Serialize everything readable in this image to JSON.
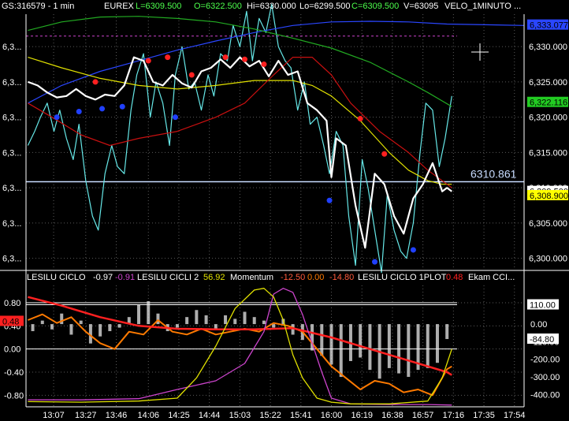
{
  "header": {
    "symbol": "GS:316579 - 1 min",
    "exchange": "EUREX",
    "last": "L=6309.500",
    "open": "O=6322.500",
    "high": "Hi=6330.000",
    "low": "Lo=6299.500",
    "close": "C=6309.500",
    "volume": "V=63095",
    "indicator": "VELO_1MINUTO",
    "dots": "..."
  },
  "indicator_header": {
    "ind1_name": "LESILU CICLO",
    "ind1_v1": "-0.97",
    "ind1_v2": "-0.91",
    "ind2_name": "LESILU CICLI 2",
    "ind2_v1": "56.92",
    "ind3_name": "Momentum",
    "ind3_v1": "-12.50",
    "ind3_v2": "0.00",
    "ind3_v3": "-14.80",
    "ind4_name": "LESILU CICLO 1PLOT",
    "ind4_v1": "0.48",
    "ind5_name": "Ekam CCI..."
  },
  "colors": {
    "background": "#000000",
    "grid": "#5a5a5a",
    "price": "#ffffff",
    "fast": "#66e8e8",
    "blue_ma": "#2a46ff",
    "green_ma": "#22aa22",
    "yellow_ma": "#e0e000",
    "red_ma": "#c81010",
    "hline": "#c8dcff",
    "magenta": "#cc44cc",
    "orange": "#ff7a00",
    "red_dot": "#ff2020",
    "blue_dot": "#2040ff"
  },
  "chart_data": [
    {
      "type": "line",
      "title": "",
      "x_ticks": [
        "13:07",
        "13:27",
        "13:46",
        "14:06",
        "14:25",
        "14:44",
        "15:03",
        "15:22",
        "15:41",
        "16:00",
        "16:19",
        "16:38",
        "16:57",
        "17:16",
        "17:35",
        "17:54"
      ],
      "y_ticks": [
        6300,
        6305,
        6310,
        6315,
        6320,
        6325,
        6330
      ],
      "y_tick_labels": [
        "6,300.000",
        "6,305.000",
        "6,310.000",
        "6,315.000",
        "6,320.000",
        "6,325.000",
        "6,330.000"
      ],
      "left_labels": [
        "6,3...",
        "6,3...",
        "6,3...",
        "6,3...",
        "6,3...",
        "6,3...",
        "6,3..."
      ],
      "ylim": [
        6298.4,
        6334.6
      ],
      "xlim": [
        12.83,
        18.0
      ],
      "horizontal_line": 6310.861,
      "horizontal_line_label": "6310.861",
      "badges": [
        {
          "text": "6,333.077",
          "value": 6333.077,
          "bg": "#2a46ff",
          "fg": "#000000"
        },
        {
          "text": "6,322.116",
          "value": 6322.116,
          "bg": "#22cc22",
          "fg": "#000000"
        },
        {
          "text": "6,309.500",
          "value": 6309.5,
          "bg": "#ffffff",
          "fg": "#000000"
        },
        {
          "text": "6,308.900",
          "value": 6308.9,
          "bg": "#ffff00",
          "fg": "#000000"
        }
      ],
      "series": [
        {
          "role": "price",
          "color": "#ffffff",
          "x": [
            12.85,
            12.95,
            13.05,
            13.15,
            13.25,
            13.35,
            13.45,
            13.55,
            13.65,
            13.75,
            13.85,
            13.95,
            14.05,
            14.15,
            14.25,
            14.35,
            14.45,
            14.55,
            14.65,
            14.75,
            14.85,
            14.95,
            15.05,
            15.15,
            15.25,
            15.35,
            15.45,
            15.55,
            15.65,
            15.75,
            15.85,
            15.95,
            16.0,
            16.05,
            16.15,
            16.25,
            16.35,
            16.45,
            16.55,
            16.65,
            16.75,
            16.85,
            16.95,
            17.05,
            17.15,
            17.2,
            17.25
          ],
          "y": [
            6325,
            6324.5,
            6323.5,
            6322.8,
            6323,
            6324,
            6323,
            6322.5,
            6323.2,
            6323,
            6324.5,
            6328.5,
            6328,
            6325,
            6324.5,
            6326,
            6324.8,
            6324.2,
            6326.5,
            6327,
            6328.2,
            6327,
            6328.5,
            6327.2,
            6328,
            6325.8,
            6328,
            6326,
            6326.5,
            6322,
            6321,
            6319.5,
            6311.5,
            6317,
            6316,
            6307.5,
            6301.5,
            6312,
            6310.5,
            6306,
            6303.5,
            6308.5,
            6310.5,
            6313.5,
            6309.5,
            6310,
            6309.5
          ]
        },
        {
          "role": "fast",
          "color": "#66e8e8",
          "x": [
            12.85,
            12.92,
            12.98,
            13.05,
            13.12,
            13.18,
            13.25,
            13.32,
            13.38,
            13.45,
            13.52,
            13.58,
            13.65,
            13.72,
            13.78,
            13.85,
            13.92,
            13.98,
            14.05,
            14.12,
            14.18,
            14.25,
            14.32,
            14.38,
            14.45,
            14.52,
            14.58,
            14.65,
            14.72,
            14.78,
            14.85,
            14.92,
            14.98,
            15.05,
            15.12,
            15.18,
            15.25,
            15.32,
            15.38,
            15.45,
            15.52,
            15.58,
            15.65,
            15.72,
            15.78,
            15.85,
            15.92,
            15.98,
            16.05,
            16.12,
            16.18,
            16.25,
            16.32,
            16.38,
            16.45,
            16.52,
            16.58,
            16.65,
            16.72,
            16.78,
            16.85,
            16.92,
            16.98,
            17.05,
            17.12,
            17.18,
            17.25
          ],
          "y": [
            6316,
            6318,
            6320,
            6322,
            6318,
            6321,
            6317,
            6314,
            6319,
            6311,
            6306,
            6304,
            6312,
            6316,
            6313,
            6312,
            6321,
            6326,
            6329,
            6320,
            6325,
            6322,
            6316,
            6326,
            6330,
            6324,
            6325,
            6321,
            6326,
            6323,
            6329,
            6328,
            6333,
            6330,
            6335,
            6328,
            6334,
            6332,
            6336,
            6330,
            6328,
            6327,
            6321,
            6325,
            6319,
            6320,
            6316,
            6312,
            6318,
            6316,
            6306,
            6299,
            6314,
            6310,
            6304,
            6298,
            6309,
            6304,
            6301,
            6300,
            6305,
            6315,
            6322,
            6321,
            6313,
            6317,
            6323
          ]
        },
        {
          "role": "ma_blue",
          "color": "#2a46ff",
          "x": [
            12.85,
            13.2,
            13.6,
            14.0,
            14.4,
            14.8,
            15.2,
            15.6,
            16.0,
            16.4,
            16.8,
            17.2,
            17.6,
            18.0
          ],
          "y": [
            6322,
            6324.5,
            6326.5,
            6328,
            6329.5,
            6330.8,
            6332,
            6333,
            6333.5,
            6333.6,
            6333.5,
            6333.2,
            6333.1,
            6333
          ]
        },
        {
          "role": "ma_green",
          "color": "#22aa22",
          "x": [
            12.85,
            13.2,
            13.6,
            14.0,
            14.4,
            14.8,
            15.2,
            15.6,
            16.0,
            16.4,
            16.8,
            17.0,
            17.25
          ],
          "y": [
            6332.3,
            6333.5,
            6334.2,
            6334.3,
            6334,
            6333.5,
            6332.5,
            6331.2,
            6329.8,
            6327.8,
            6325,
            6323.5,
            6321.5
          ]
        },
        {
          "role": "ma_yellow",
          "color": "#e0e000",
          "x": [
            12.85,
            13.2,
            13.6,
            14.0,
            14.4,
            14.8,
            15.2,
            15.6,
            15.8,
            16.0,
            16.3,
            16.6,
            16.8,
            17.0,
            17.15,
            17.25
          ],
          "y": [
            6328.5,
            6327,
            6325.5,
            6324.5,
            6324,
            6324.5,
            6325.2,
            6325.2,
            6324.5,
            6323,
            6319.5,
            6315,
            6312.5,
            6311,
            6310.5,
            6310.5
          ]
        },
        {
          "role": "ma_red",
          "color": "#c81010",
          "x": [
            12.85,
            13.1,
            13.4,
            13.7,
            14.0,
            14.4,
            14.8,
            15.1,
            15.4,
            15.6,
            15.8,
            16.0,
            16.2,
            16.5,
            16.8,
            17.0,
            17.2,
            17.25
          ],
          "y": [
            6322,
            6320,
            6317.5,
            6316,
            6317,
            6318,
            6320,
            6322,
            6326,
            6328.5,
            6328.5,
            6326,
            6322,
            6318,
            6315,
            6312.5,
            6310.5,
            6310
          ]
        },
        {
          "role": "sar_hi",
          "color": "#ff2020",
          "marker": "dot",
          "x": [
            13.55,
            14.1,
            14.3,
            14.55,
            14.9,
            15.1,
            15.3,
            16.3,
            16.55
          ],
          "y": [
            6325,
            6328,
            6328.5,
            6326,
            6328.5,
            6328.2,
            6327.5,
            6319.8,
            6314.8
          ]
        },
        {
          "role": "sar_lo",
          "color": "#2040ff",
          "marker": "dot",
          "x": [
            13.15,
            13.38,
            13.62,
            13.83,
            14.38,
            15.98,
            16.45,
            16.85
          ],
          "y": [
            6320,
            6320.8,
            6321.2,
            6321.5,
            6320,
            6308.2,
            6299.5,
            6301.2
          ]
        }
      ]
    },
    {
      "type": "line",
      "title": "",
      "x_ticks": [
        "13:07",
        "13:27",
        "13:46",
        "14:06",
        "14:25",
        "14:44",
        "15:03",
        "15:22",
        "15:41",
        "16:00",
        "16:19",
        "16:38",
        "16:57",
        "17:16",
        "17:35",
        "17:54"
      ],
      "y_ticks_left": [
        0.8,
        0.4,
        0.0,
        -0.4,
        -0.8
      ],
      "y_tick_labels_left": [
        "0.80",
        "0.40",
        "0.00",
        "-0.40",
        "-0.80"
      ],
      "y_ticks_right": [
        110,
        0,
        -100,
        -200,
        -300,
        -400
      ],
      "y_tick_labels_right": [
        "110.00",
        "0.00",
        "-110.00",
        "-200.00",
        "-300.00",
        "-400.00"
      ],
      "ylim_left": [
        -1.0,
        1.1
      ],
      "ylim_right": [
        -470,
        220
      ],
      "badges": [
        {
          "text": "0.48",
          "value": 0.48,
          "axis": "left",
          "bg": "#ff2020",
          "fg": "#000000"
        },
        {
          "text": "110.00",
          "value": 110,
          "axis": "right",
          "bg": "#ffffff",
          "fg": "#000000"
        },
        {
          "text": "-84.80",
          "value": -84.8,
          "axis": "right",
          "bg": "#ffffff",
          "fg": "#000000"
        }
      ],
      "series": [
        {
          "role": "hist_momentum",
          "color": "#e8e8e8",
          "axis": "right",
          "x": [
            12.9,
            13.0,
            13.1,
            13.2,
            13.3,
            13.4,
            13.5,
            13.6,
            13.7,
            13.8,
            13.9,
            14.0,
            14.1,
            14.2,
            14.3,
            14.4,
            14.5,
            14.6,
            14.7,
            14.8,
            14.9,
            15.0,
            15.1,
            15.2,
            15.3,
            15.4,
            15.5,
            15.6,
            15.7,
            15.8,
            15.9,
            16.0,
            16.1,
            16.2,
            16.3,
            16.4,
            16.5,
            16.6,
            16.7,
            16.8,
            16.9,
            17.0,
            17.1,
            17.2
          ],
          "y": [
            -40,
            20,
            -30,
            60,
            -60,
            20,
            -110,
            -70,
            -40,
            -20,
            40,
            110,
            130,
            60,
            -40,
            -20,
            40,
            80,
            50,
            -30,
            50,
            30,
            70,
            40,
            20,
            -20,
            30,
            -60,
            -90,
            -150,
            -180,
            -230,
            -300,
            -210,
            -190,
            -260,
            -310,
            -250,
            -280,
            -300,
            -260,
            -250,
            -220,
            -84.8
          ]
        },
        {
          "role": "cycle_orange",
          "color": "#ff7a00",
          "axis": "left",
          "x": [
            12.85,
            13.0,
            13.15,
            13.3,
            13.45,
            13.6,
            13.75,
            13.9,
            14.05,
            14.2,
            14.35,
            14.5,
            14.65,
            14.8,
            14.95,
            15.1,
            15.25,
            15.4,
            15.55,
            15.7,
            15.85,
            16.0,
            16.15,
            16.3,
            16.45,
            16.6,
            16.75,
            16.9,
            17.05,
            17.2,
            17.25
          ],
          "y": [
            0.5,
            0.6,
            0.45,
            0.55,
            0.3,
            0.1,
            0.0,
            0.3,
            0.25,
            0.5,
            0.3,
            0.25,
            0.35,
            0.25,
            0.3,
            0.35,
            0.3,
            0.45,
            0.4,
            0.3,
            0.0,
            -0.3,
            -0.5,
            -0.7,
            -0.55,
            -0.6,
            -0.75,
            -0.7,
            -0.8,
            -0.35,
            -0.3
          ]
        },
        {
          "role": "cycle_red",
          "color": "#ff2020",
          "axis": "left",
          "x": [
            12.85,
            13.2,
            13.6,
            14.0,
            14.4,
            14.8,
            15.2,
            15.6,
            16.0,
            16.4,
            16.8,
            17.2,
            17.25
          ],
          "y": [
            0.9,
            0.75,
            0.55,
            0.4,
            0.35,
            0.34,
            0.34,
            0.36,
            0.2,
            0.0,
            -0.2,
            -0.4,
            -0.45
          ]
        },
        {
          "role": "cycle_magenta",
          "color": "#cc44cc",
          "axis": "left",
          "x": [
            12.85,
            13.4,
            14.0,
            14.4,
            14.8,
            15.1,
            15.3,
            15.4,
            15.5,
            15.6,
            15.7,
            15.8,
            15.9,
            16.0,
            16.2,
            16.6,
            17.0,
            17.25
          ],
          "y": [
            -0.88,
            -0.88,
            -0.86,
            -0.7,
            -0.55,
            -0.25,
            0.3,
            0.95,
            1.05,
            0.98,
            0.6,
            0.1,
            -0.4,
            -0.85,
            -0.95,
            -0.96,
            -0.96,
            -0.97
          ]
        },
        {
          "role": "cycle_yellow",
          "color": "#e0e000",
          "axis": "left",
          "x": [
            12.85,
            13.4,
            14.0,
            14.4,
            14.6,
            14.8,
            15.0,
            15.2,
            15.3,
            15.4,
            15.5,
            15.6,
            15.7,
            15.85,
            16.0,
            16.2,
            16.6,
            17.0,
            17.15,
            17.25
          ],
          "y": [
            -0.91,
            -0.92,
            -0.9,
            -0.85,
            -0.5,
            0.05,
            0.7,
            1.02,
            1.05,
            0.9,
            0.5,
            -0.1,
            -0.5,
            -0.85,
            -0.92,
            -0.95,
            -0.95,
            -0.9,
            -0.5,
            0.0
          ]
        }
      ]
    }
  ]
}
